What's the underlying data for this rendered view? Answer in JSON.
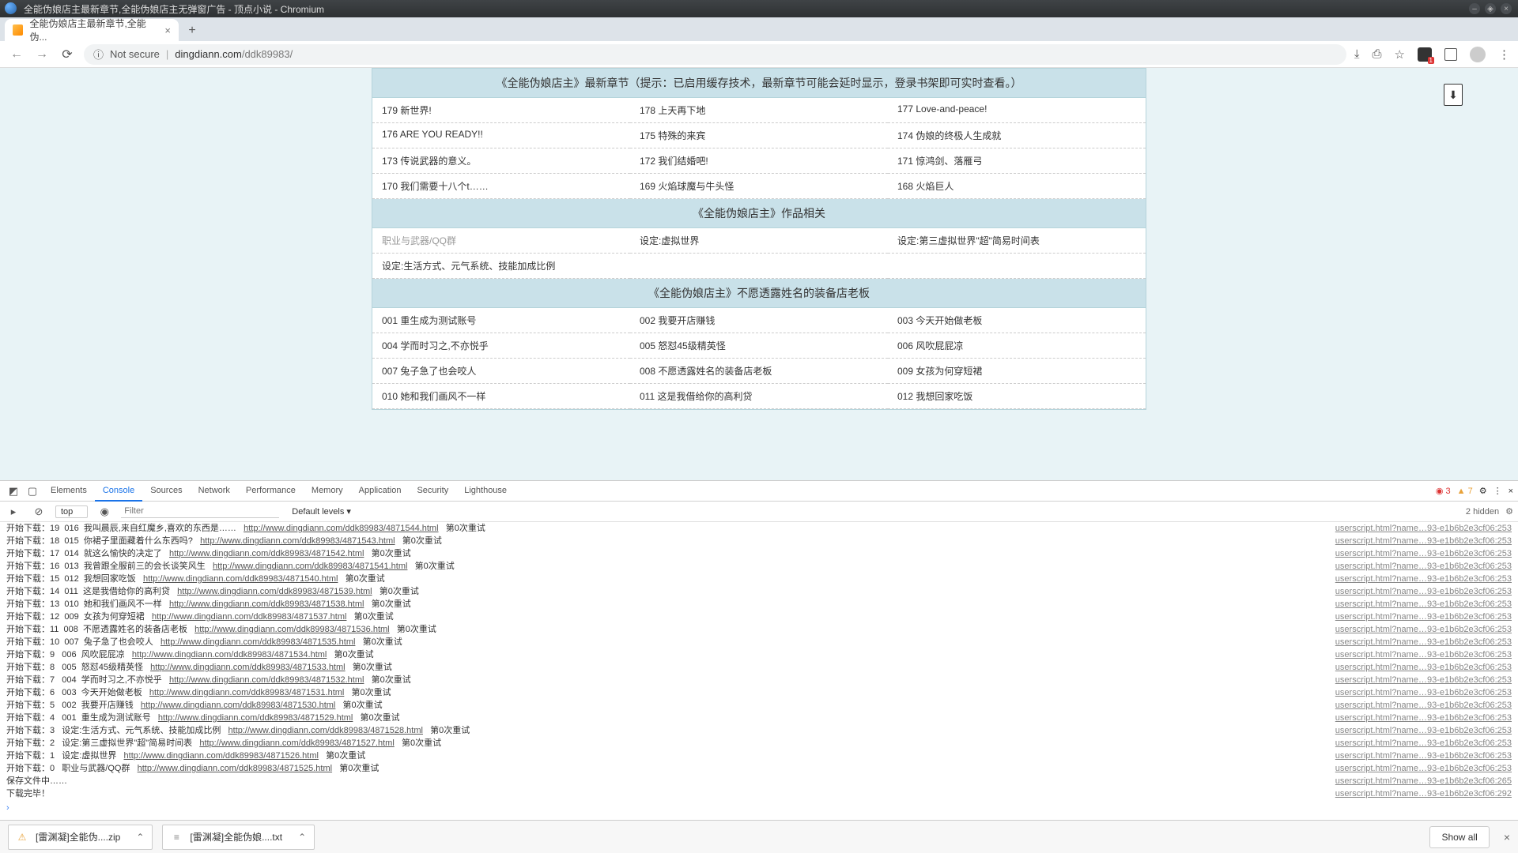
{
  "window": {
    "title": "全能伪娘店主最新章节,全能伪娘店主无弹窗广告 - 顶点小说 - Chromium"
  },
  "tab": {
    "title": "全能伪娘店主最新章节,全能伪..."
  },
  "url": {
    "scheme_warning": "Not secure",
    "host": "dingdiann.com",
    "path": "/ddk89983/"
  },
  "sections": {
    "latest_header": "《全能伪娘店主》最新章节（提示：已启用缓存技术，最新章节可能会延时显示，登录书架即可实时查看。）",
    "related_header": "《全能伪娘店主》作品相关",
    "volume_header": "《全能伪娘店主》不愿透露姓名的装备店老板"
  },
  "latest_chapters": [
    "179 新世界!",
    "178 上天再下地",
    "177 Love-and-peace!",
    "176 ARE YOU READY!!",
    "175 特殊的来宾",
    "174 伪娘的终极人生成就",
    "173 传说武器的意义。",
    "172 我们结婚吧!",
    "171 惊鸿剑、落雁弓",
    "170 我们需要十八个t……",
    "169 火焰球魔与牛头怪",
    "168 火焰巨人"
  ],
  "related_items": [
    "职业与武器/QQ群",
    "设定:虚拟世界",
    "设定:第三虚拟世界\"超\"简易时间表",
    "设定:生活方式、元气系统、技能加成比例",
    "",
    ""
  ],
  "volume_chapters": [
    "001 重生成为测试账号",
    "002 我要开店赚钱",
    "003 今天开始做老板",
    "004 学而时习之,不亦悦乎",
    "005 怒怼45级精英怪",
    "006 风吹屁屁凉",
    "007 兔子急了也会咬人",
    "008 不愿透露姓名的装备店老板",
    "009 女孩为何穿短裙",
    "010 她和我们画风不一样",
    "011 这是我借给你的高利贷",
    "012 我想回家吃饭"
  ],
  "devtools": {
    "tabs": [
      "Elements",
      "Console",
      "Sources",
      "Network",
      "Performance",
      "Memory",
      "Application",
      "Security",
      "Lighthouse"
    ],
    "active_tab": "Console",
    "errors": "3",
    "warnings": "7",
    "context": "top",
    "filter_placeholder": "Filter",
    "levels": "Default levels ▾",
    "hidden": "2 hidden",
    "source_link": "userscript.html?name…93-e1b6b2e3cf06:253",
    "source_link_265": "userscript.html?name…93-e1b6b2e3cf06:265",
    "source_link_292": "userscript.html?name…93-e1b6b2e3cf06:292",
    "logs": [
      {
        "pre": "开始下载：19  016  我叫晨辰,来自红魔乡,喜欢的东西是……   ",
        "url": "http://www.dingdiann.com/ddk89983/4871544.html",
        "post": "   第0次重试"
      },
      {
        "pre": "开始下载：18  015  你裙子里面藏着什么东西吗?   ",
        "url": "http://www.dingdiann.com/ddk89983/4871543.html",
        "post": "   第0次重试"
      },
      {
        "pre": "开始下载：17  014  就这么愉快的决定了   ",
        "url": "http://www.dingdiann.com/ddk89983/4871542.html",
        "post": "   第0次重试"
      },
      {
        "pre": "开始下载：16  013  我曾跟全服前三的会长谈笑风生   ",
        "url": "http://www.dingdiann.com/ddk89983/4871541.html",
        "post": "   第0次重试"
      },
      {
        "pre": "开始下载：15  012  我想回家吃饭   ",
        "url": "http://www.dingdiann.com/ddk89983/4871540.html",
        "post": "   第0次重试"
      },
      {
        "pre": "开始下载：14  011  这是我借给你的高利贷   ",
        "url": "http://www.dingdiann.com/ddk89983/4871539.html",
        "post": "   第0次重试"
      },
      {
        "pre": "开始下载：13  010  她和我们画风不一样   ",
        "url": "http://www.dingdiann.com/ddk89983/4871538.html",
        "post": "   第0次重试"
      },
      {
        "pre": "开始下载：12  009  女孩为何穿短裙   ",
        "url": "http://www.dingdiann.com/ddk89983/4871537.html",
        "post": "   第0次重试"
      },
      {
        "pre": "开始下载：11  008  不愿透露姓名的装备店老板   ",
        "url": "http://www.dingdiann.com/ddk89983/4871536.html",
        "post": "   第0次重试"
      },
      {
        "pre": "开始下载：10  007  兔子急了也会咬人   ",
        "url": "http://www.dingdiann.com/ddk89983/4871535.html",
        "post": "   第0次重试"
      },
      {
        "pre": "开始下载：9   006  风吹屁屁凉   ",
        "url": "http://www.dingdiann.com/ddk89983/4871534.html",
        "post": "   第0次重试"
      },
      {
        "pre": "开始下载：8   005  怒怼45级精英怪   ",
        "url": "http://www.dingdiann.com/ddk89983/4871533.html",
        "post": "   第0次重试"
      },
      {
        "pre": "开始下载：7   004  学而时习之,不亦悦乎   ",
        "url": "http://www.dingdiann.com/ddk89983/4871532.html",
        "post": "   第0次重试"
      },
      {
        "pre": "开始下载：6   003  今天开始做老板   ",
        "url": "http://www.dingdiann.com/ddk89983/4871531.html",
        "post": "   第0次重试"
      },
      {
        "pre": "开始下载：5   002  我要开店赚钱   ",
        "url": "http://www.dingdiann.com/ddk89983/4871530.html",
        "post": "   第0次重试"
      },
      {
        "pre": "开始下载：4   001  重生成为测试账号   ",
        "url": "http://www.dingdiann.com/ddk89983/4871529.html",
        "post": "   第0次重试"
      },
      {
        "pre": "开始下载：3   设定:生活方式、元气系统、技能加成比例   ",
        "url": "http://www.dingdiann.com/ddk89983/4871528.html",
        "post": "   第0次重试"
      },
      {
        "pre": "开始下载：2   设定:第三虚拟世界\"超\"简易时间表   ",
        "url": "http://www.dingdiann.com/ddk89983/4871527.html",
        "post": "   第0次重试"
      },
      {
        "pre": "开始下载：1   设定:虚拟世界   ",
        "url": "http://www.dingdiann.com/ddk89983/4871526.html",
        "post": "   第0次重试"
      },
      {
        "pre": "开始下载：0   职业与武器/QQ群   ",
        "url": "http://www.dingdiann.com/ddk89983/4871525.html",
        "post": "   第0次重试"
      }
    ],
    "tail": [
      "保存文件中……",
      "下载完毕！"
    ]
  },
  "downloads": {
    "items": [
      {
        "name": "[雷渊凝]全能伪....zip"
      },
      {
        "name": "[雷渊凝]全能伪娘....txt"
      }
    ],
    "show_all": "Show all"
  }
}
